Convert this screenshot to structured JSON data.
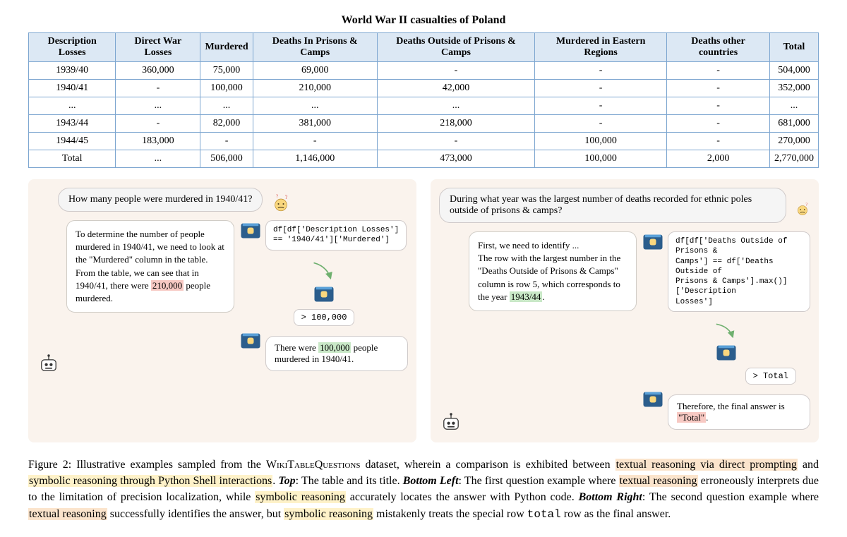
{
  "title": "World War II casualties of Poland",
  "table": {
    "headers": [
      "Description Losses",
      "Direct War Losses",
      "Murdered",
      "Deaths In Prisons & Camps",
      "Deaths Outside of Prisons & Camps",
      "Murdered in Eastern Regions",
      "Deaths other countries",
      "Total"
    ],
    "rows": [
      [
        "1939/40",
        "360,000",
        "75,000",
        "69,000",
        "-",
        "-",
        "-",
        "504,000"
      ],
      [
        "1940/41",
        "-",
        "100,000",
        "210,000",
        "42,000",
        "-",
        "-",
        "352,000"
      ],
      [
        "...",
        "...",
        "...",
        "...",
        "...",
        "-",
        "-",
        "..."
      ],
      [
        "1943/44",
        "-",
        "82,000",
        "381,000",
        "218,000",
        "-",
        "-",
        "681,000"
      ],
      [
        "1944/45",
        "183,000",
        "-",
        "-",
        "-",
        "100,000",
        "-",
        "270,000"
      ],
      [
        "Total",
        "...",
        "506,000",
        "1,146,000",
        "473,000",
        "100,000",
        "2,000",
        "2,770,000"
      ]
    ]
  },
  "example1": {
    "question": "How many people were murdered in 1940/41?",
    "text_reason_pre": "To determine the number of people murdered in 1940/41, we need to look at the \"Murdered\" column in the table. From the table, we can see that in 1940/41, there were ",
    "text_reason_hl": "210,000",
    "text_reason_post": " people murdered.",
    "code": "df[df['Description Losses']\n== '1940/41']['Murdered']",
    "output": "> 100,000",
    "answer_pre": "There were ",
    "answer_hl": "100,000",
    "answer_post": " people murdered in 1940/41."
  },
  "example2": {
    "question": "During what year was the largest number of deaths recorded for ethnic poles outside of prisons & camps?",
    "text_reason_pre": "First, we need to identify ...\n The row with the largest number in the \"Deaths Outside of Prisons & Camps\" column is row 5, which corresponds to the year ",
    "text_reason_hl": "1943/44",
    "text_reason_post": ".",
    "code": "df[df['Deaths Outside of Prisons &\nCamps'] == df['Deaths Outside of\nPrisons & Camps'].max()]['Description\nLosses']",
    "output": "> Total",
    "answer_pre": "Therefore, the final answer is ",
    "answer_hl": "\"Total\"",
    "answer_post": "."
  },
  "caption": {
    "fig_label": "Figure 2:",
    "s1a": " Illustrative examples sampled from the ",
    "dataset": "WikiTableQuestions",
    "s1b": " dataset, wherein a comparison is exhibited between ",
    "phrase1": "textual reasoning via direct prompting",
    "s1c": " and ",
    "phrase2": "symbolic reasoning through Python Shell interactions",
    "s1d": ". ",
    "top_label": "Top",
    "s2": ": The table and its title. ",
    "bl_label": "Bottom Left",
    "s3a": ": The first question example where ",
    "phrase3": "textual reasoning",
    "s3b": " erroneously interprets due to the limitation of precision localization, while ",
    "phrase4": "symbolic reasoning",
    "s3c": " accurately locates the answer with Python code. ",
    "br_label": "Bottom Right",
    "s4a": ": The second question example where ",
    "phrase5": "textual reasoning",
    "s4b": " successfully identifies the answer, but ",
    "phrase6": "symbolic reasoning",
    "s4c": " mistakenly treats the special row ",
    "code_tok": "total",
    "s4d": " row as the final answer."
  }
}
